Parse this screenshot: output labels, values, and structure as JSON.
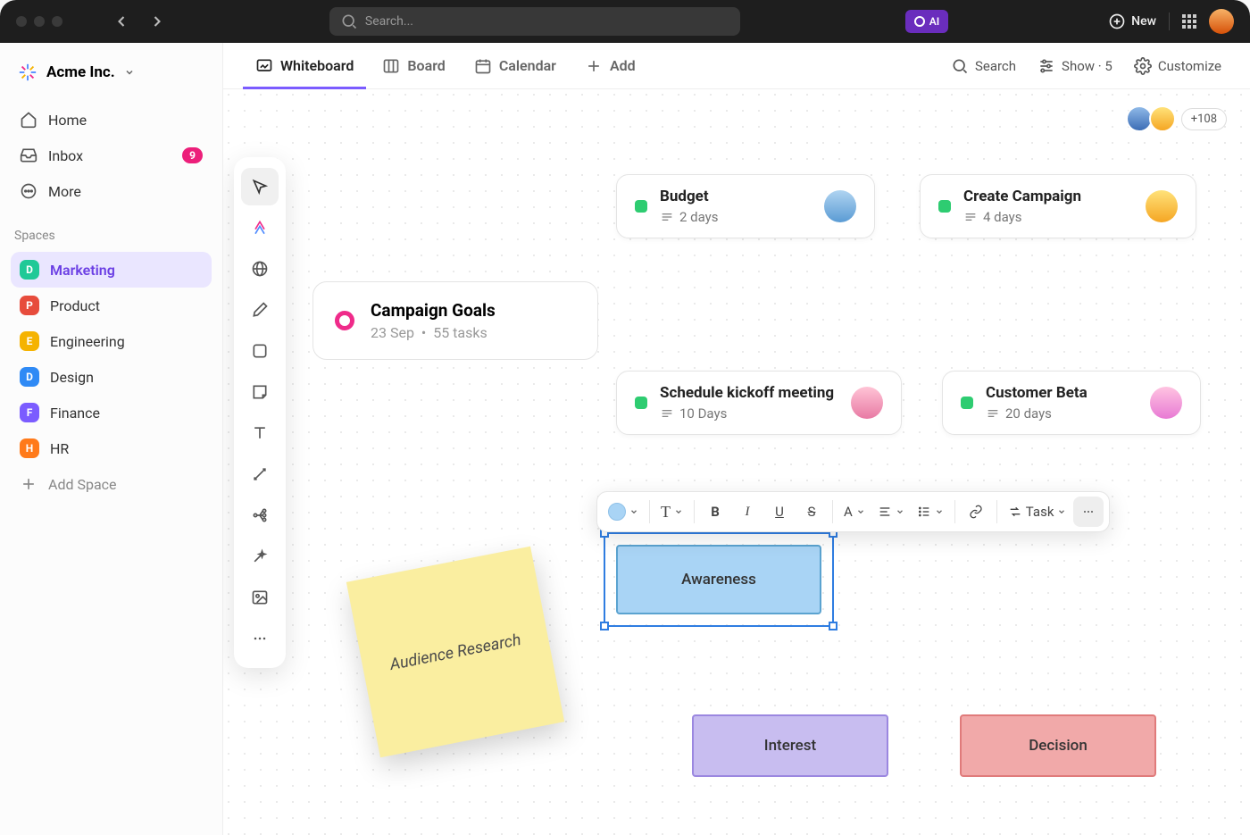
{
  "titlebar": {
    "search_placeholder": "Search...",
    "ai_label": "AI",
    "new_label": "New"
  },
  "workspace": {
    "name": "Acme Inc."
  },
  "nav": {
    "home": "Home",
    "inbox": "Inbox",
    "inbox_badge": "9",
    "more": "More"
  },
  "spaces_label": "Spaces",
  "spaces": [
    {
      "letter": "D",
      "color": "#20c997",
      "name": "Marketing",
      "active": true
    },
    {
      "letter": "P",
      "color": "#e74c3c",
      "name": "Product"
    },
    {
      "letter": "E",
      "color": "#f5b301",
      "name": "Engineering"
    },
    {
      "letter": "D",
      "color": "#2f8af5",
      "name": "Design"
    },
    {
      "letter": "F",
      "color": "#7b5cff",
      "name": "Finance"
    },
    {
      "letter": "H",
      "color": "#ff7a1a",
      "name": "HR"
    }
  ],
  "add_space": "Add Space",
  "tabs": {
    "whiteboard": "Whiteboard",
    "board": "Board",
    "calendar": "Calendar",
    "add": "Add",
    "search": "Search",
    "show": "Show · 5",
    "customize": "Customize"
  },
  "presence_more": "+108",
  "goals": {
    "title": "Campaign Goals",
    "date": "23 Sep",
    "tasks": "55 tasks"
  },
  "cards": {
    "budget": {
      "title": "Budget",
      "sub": "2 days"
    },
    "create_campaign": {
      "title": "Create Campaign",
      "sub": "4 days"
    },
    "schedule_kickoff": {
      "title": "Schedule kickoff meeting",
      "sub": "10 Days"
    },
    "customer_beta": {
      "title": "Customer Beta",
      "sub": "20 days"
    }
  },
  "sticky": {
    "text": "Audience Research"
  },
  "flow": {
    "awareness": "Awareness",
    "interest": "Interest",
    "decision": "Decision"
  },
  "toolbar": {
    "task": "Task"
  }
}
